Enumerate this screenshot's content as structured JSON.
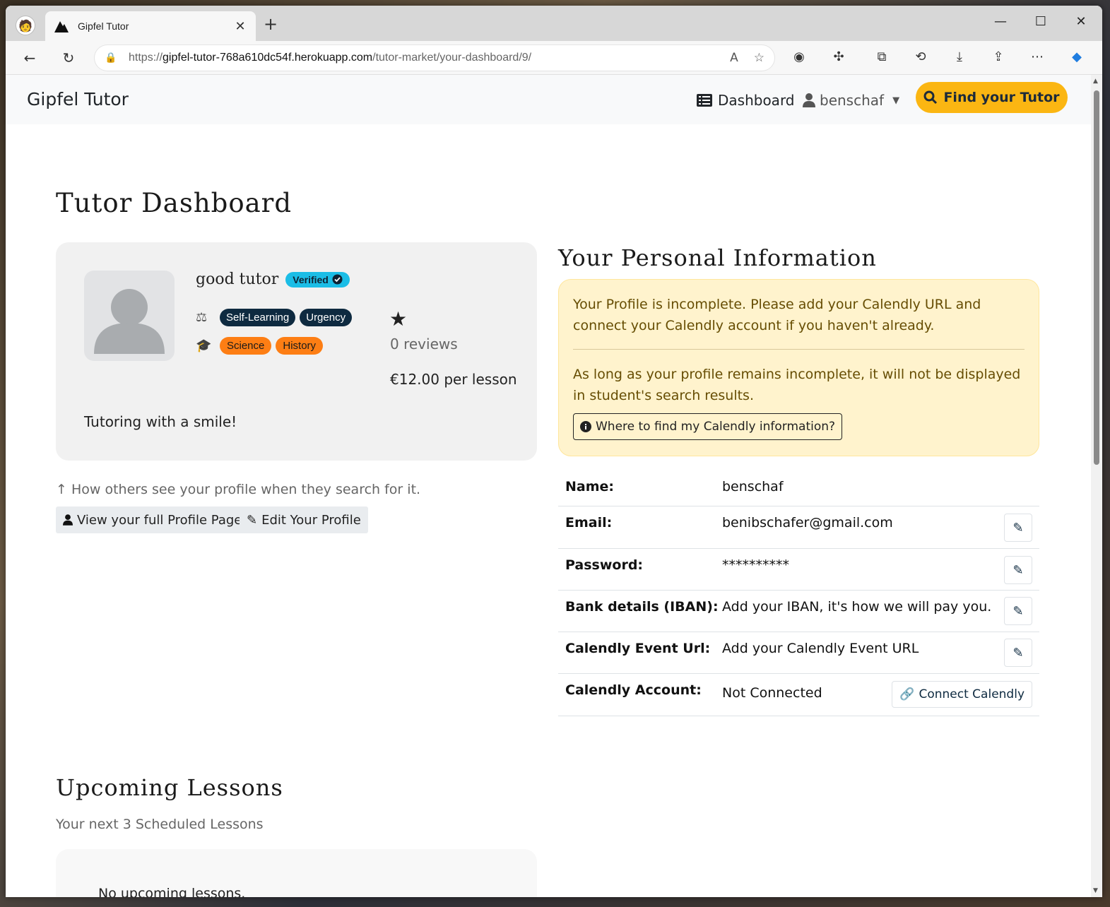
{
  "browser": {
    "tab_title": "Gipfel Tutor",
    "url_prefix": "https://",
    "url_host": "gipfel-tutor-768a610dc54f.herokuapp.com",
    "url_path": "/tutor-market/your-dashboard/9/"
  },
  "navbar": {
    "brand": "Gipfel Tutor",
    "dashboard_label": "Dashboard",
    "user_label": "benschaf",
    "find_label": "Find your Tutor",
    "accent": "#fbb612"
  },
  "page": {
    "title": "Tutor Dashboard"
  },
  "profile_card": {
    "name": "good tutor",
    "verified_label": "Verified",
    "learning_styles": [
      "Self-Learning",
      "Urgency"
    ],
    "subjects": [
      "Science",
      "History"
    ],
    "reviews": "0 reviews",
    "price": "€12.00 per lesson",
    "tagline": "Tutoring with a smile!"
  },
  "profile_hint": "How others see your profile when they search for it.",
  "buttons": {
    "view_profile": "View your full Profile Page",
    "edit_profile": "Edit Your Profile"
  },
  "personal_info": {
    "title": "Your Personal Information",
    "alert_line1": "Your Profile is incomplete. Please add your Calendly URL and connect your Calendly account if you haven't already.",
    "alert_line2": "As long as your profile remains incomplete, it will not be displayed in student's search results.",
    "alert_button": "Where to find my Calendly information?",
    "rows": [
      {
        "label": "Name:",
        "value": "benschaf"
      },
      {
        "label": "Email:",
        "value": "benibschafer@gmail.com"
      },
      {
        "label": "Password:",
        "value": "**********"
      },
      {
        "label": "Bank details (IBAN):",
        "value": "Add your IBAN, it's how we will pay you."
      },
      {
        "label": "Calendly Event Url:",
        "value": "Add your Calendly Event URL"
      },
      {
        "label": "Calendly Account:",
        "value": "Not Connected"
      }
    ],
    "connect_label": "Connect Calendly"
  },
  "lessons": {
    "title": "Upcoming Lessons",
    "subtitle": "Your next 3 Scheduled Lessons",
    "empty": "No upcoming lessons."
  }
}
